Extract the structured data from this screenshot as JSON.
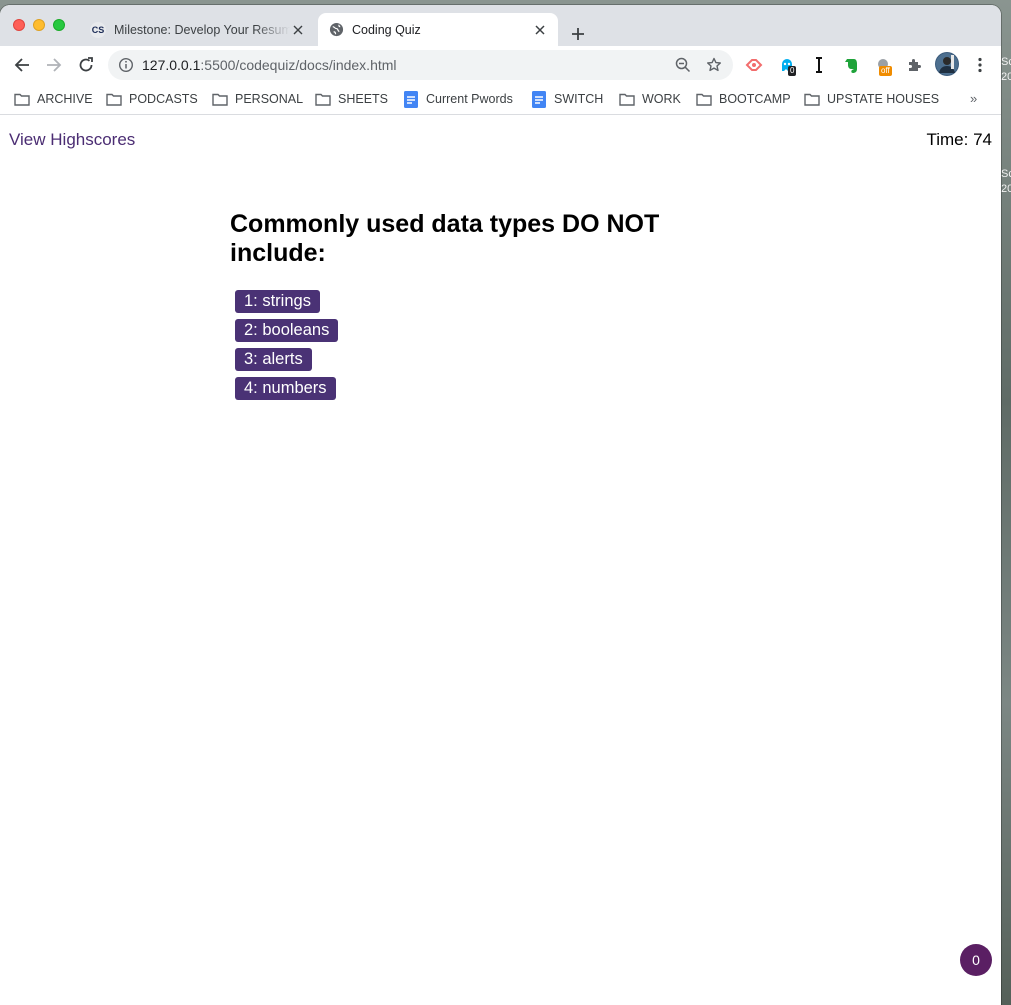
{
  "desktop": {
    "right_text_1": "Sc",
    "right_text_2": "20",
    "right_text_3": "Sc",
    "right_text_4": "20"
  },
  "tabs": [
    {
      "title": "Milestone: Develop Your Resume",
      "favicon": "CS"
    },
    {
      "title": "Coding Quiz",
      "favicon": "globe-icon"
    }
  ],
  "address_bar": {
    "url_host": "127.0.0.1",
    "url_rest": ":5500/codequiz/docs/index.html"
  },
  "extensions": {
    "ghost_badge": "0",
    "off_badge": "off"
  },
  "bookmarks": [
    {
      "label": "ARCHIVE",
      "icon": "folder-icon"
    },
    {
      "label": "PODCASTS",
      "icon": "folder-icon"
    },
    {
      "label": "PERSONAL",
      "icon": "folder-icon"
    },
    {
      "label": "SHEETS",
      "icon": "folder-icon"
    },
    {
      "label": "Current Pwords",
      "icon": "doc-icon"
    },
    {
      "label": "SWITCH",
      "icon": "doc-icon"
    },
    {
      "label": "WORK",
      "icon": "folder-icon"
    },
    {
      "label": "BOOTCAMP",
      "icon": "folder-icon"
    },
    {
      "label": "UPSTATE HOUSES",
      "icon": "folder-icon"
    }
  ],
  "bookmarks_more": "»",
  "page": {
    "highscores_link": "View Highscores",
    "timer": "Time: 74",
    "question": "Commonly used data types DO NOT include:",
    "answers": [
      "1: strings",
      "2: booleans",
      "3: alerts",
      "4: numbers"
    ],
    "chat_count": "0"
  },
  "colors": {
    "accent": "#4a3275",
    "link": "#4b2d73",
    "chat": "#5a1f63"
  }
}
